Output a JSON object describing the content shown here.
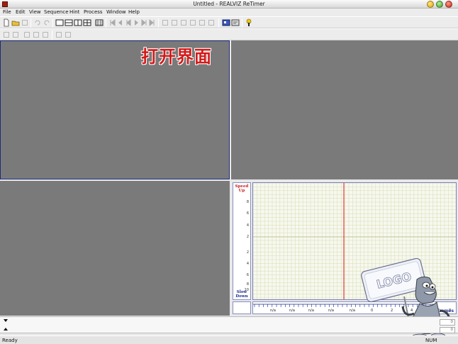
{
  "window": {
    "title": "Untitled - REALVIZ ReTimer"
  },
  "menu": [
    "File",
    "Edit",
    "View",
    "Sequence",
    "Hint",
    "Process",
    "Window",
    "Help"
  ],
  "overlay_caption": "打开界面",
  "curve_editor": {
    "top_label": [
      "Speed",
      "Up"
    ],
    "bottom_label": [
      "Slow",
      "Down"
    ],
    "y_ticks": [
      "8",
      "6",
      "4",
      "2",
      "",
      "2",
      "4",
      "6",
      "8",
      "10"
    ],
    "x_ticks": [
      "n/a",
      "n/a",
      "n/a",
      "n/a",
      "n/a",
      "0",
      "2",
      "4",
      "6",
      "8"
    ],
    "frames_label": "Frames"
  },
  "logo_card_text": "LOGO",
  "side_fields": [
    "0",
    "0"
  ],
  "status": {
    "text": "Ready",
    "num": "NUM"
  },
  "colors": {
    "viewport": "#7a7a7a",
    "active_border": "#1d2b7c",
    "caption": "#d41818",
    "playhead": "#e21a1a",
    "grid_line": "#d7dcb4"
  },
  "icons": {
    "toolbar1": [
      "new-file-icon",
      "open-folder-icon",
      "save-icon",
      "undo-icon",
      "redo-icon",
      "layout-single-icon",
      "layout-two-vertical-icon",
      "layout-two-horizontal-icon",
      "layout-quad-icon",
      "grid-icon",
      "go-start-icon",
      "step-back-icon",
      "play-back-icon",
      "play-icon",
      "step-forward-icon",
      "go-end-icon",
      "ruler-icon",
      "frame-icon",
      "key-icon",
      "split-icon",
      "camera-icon",
      "marker-icon",
      "process-icon",
      "export-icon",
      "help-icon"
    ],
    "toolbar2": [
      "mode-1-icon",
      "mode-2-icon",
      "mode-3-icon",
      "mode-4-icon",
      "mode-5-icon",
      "mode-6-icon",
      "mode-7-icon"
    ]
  }
}
